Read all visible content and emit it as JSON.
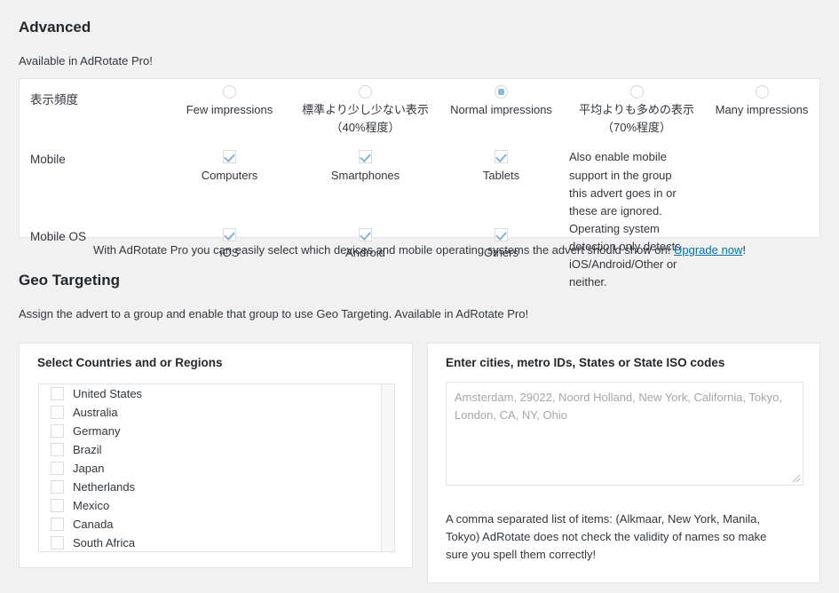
{
  "advanced": {
    "title": "Advanced",
    "subtitle": "Available in AdRotate Pro!",
    "rows": {
      "frequency_label": "表示頻度",
      "mobile_label": "Mobile",
      "mobile_os_label": "Mobile OS"
    },
    "frequency_options": [
      {
        "label": "Few impressions",
        "selected": false
      },
      {
        "label": "標準より少し少ない表示（40%程度）",
        "selected": false
      },
      {
        "label": "Normal impressions",
        "selected": true
      },
      {
        "label": "平均よりも多めの表示（70%程度）",
        "selected": false
      },
      {
        "label": "Many impressions",
        "selected": false
      }
    ],
    "mobile_options": [
      {
        "label": "Computers",
        "checked": true
      },
      {
        "label": "Smartphones",
        "checked": true
      },
      {
        "label": "Tablets",
        "checked": true
      }
    ],
    "mobile_os_options": [
      {
        "label": "iOS",
        "checked": true
      },
      {
        "label": "Android",
        "checked": true
      },
      {
        "label": "Others",
        "checked": true
      }
    ],
    "mobile_help": "Also enable mobile support in the group this advert goes in or these are ignored. Operating system detection only detects iOS/Android/Other or neither.",
    "note_text": "With AdRotate Pro you can easily select which devices and mobile operating systems the advert should show on! ",
    "note_link": "Upgrade now",
    "note_tail": "!"
  },
  "geo": {
    "title": "Geo Targeting",
    "subtitle": "Assign the advert to a group and enable that group to use Geo Targeting. Available in AdRotate Pro!",
    "countries_heading": "Select Countries and or Regions",
    "countries": [
      {
        "label": "United States",
        "checked": false
      },
      {
        "label": "Australia",
        "checked": false
      },
      {
        "label": "Germany",
        "checked": false
      },
      {
        "label": "Brazil",
        "checked": false
      },
      {
        "label": "Japan",
        "checked": false
      },
      {
        "label": "Netherlands",
        "checked": false
      },
      {
        "label": "Mexico",
        "checked": false
      },
      {
        "label": "Canada",
        "checked": false
      },
      {
        "label": "South Africa",
        "checked": false
      }
    ],
    "cities_heading": "Enter cities, metro IDs, States or State ISO codes",
    "cities_placeholder": "Amsterdam, 29022, Noord Holland, New York, California, Tokyo, London, CA, NY, Ohio",
    "cities_value": "",
    "cities_help": "A comma separated list of items: (Alkmaar, New York, Manila, Tokyo) AdRotate does not check the validity of names so make sure you spell them correctly!"
  },
  "colors": {
    "page_bg": "#f1f1f1",
    "panel_bg": "#ffffff",
    "border": "#e5e5e5",
    "accent_blue": "#89b9e0",
    "link_blue": "#0073aa",
    "text": "#32373c"
  }
}
